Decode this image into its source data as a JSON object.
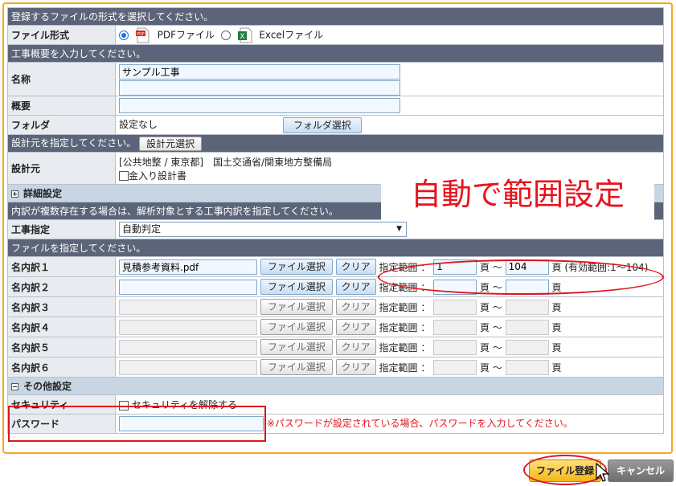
{
  "format_section": {
    "header": "登録するファイルの形式を選択してください。",
    "label": "ファイル形式",
    "pdf_label": "PDFファイル",
    "excel_label": "Excelファイル",
    "pdf_badge": "PDF",
    "excel_badge": "X"
  },
  "overview_section": {
    "header": "工事概要を入力してください。",
    "name_label": "名称",
    "name_value": "サンプル工事",
    "summary_label": "概要",
    "folder_label": "フォルダ",
    "folder_value": "設定なし",
    "folder_button": "フォルダ選択"
  },
  "designer_section": {
    "header": "設計元を指定してください。",
    "select_button": "設計元選択",
    "label": "設計元",
    "value": "[公共地整 / 東京都]　国土交通省/関東地方整備局",
    "checkbox_label": "金入り設計書"
  },
  "advanced": {
    "toggle": "+",
    "label": "詳細設定"
  },
  "breakdown_section": {
    "header": "内訳が複数存在する場合は、解析対象とする工事内訳を指定してください。",
    "label": "工事指定",
    "value": "自動判定",
    "arrow": "▼"
  },
  "files_section": {
    "header": "ファイルを指定してください。",
    "select_button": "ファイル選択",
    "clear_button": "クリア",
    "range_label": "指定範囲 ：",
    "page_sep": "頁 ～",
    "page_unit": "頁",
    "rows": [
      {
        "label": "名内訳１",
        "file": "見積参考資料.pdf",
        "from": "1",
        "to": "104",
        "valid": "(有効範囲:1～104)"
      },
      {
        "label": "名内訳２"
      },
      {
        "label": "名内訳３"
      },
      {
        "label": "名内訳４"
      },
      {
        "label": "名内訳５"
      },
      {
        "label": "名内訳６"
      }
    ]
  },
  "other_section": {
    "toggle": "−",
    "label": "その他設定",
    "security_label": "セキュリティ",
    "security_checkbox": "セキュリティを解除する",
    "password_label": "パスワード",
    "password_note": "※パスワードが設定されている場合、パスワードを入力してください。"
  },
  "annotation": {
    "text": "自動で範囲設定"
  },
  "footer": {
    "submit": "ファイル登録",
    "cancel": "キャンセル"
  },
  "colors": {
    "accent": "#f5a623",
    "header_bg": "#5b6478",
    "annotation": "#e0141e"
  }
}
